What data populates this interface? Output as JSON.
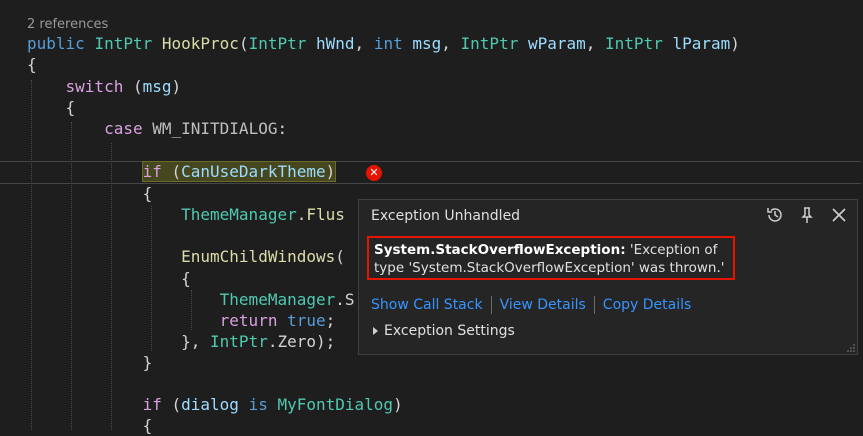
{
  "editor": {
    "codelens": "2 references",
    "code": {
      "l1": {
        "public": "public",
        "ret": "IntPtr",
        "fn": "HookProc",
        "p1t": "IntPtr",
        "p1": "hWnd",
        "p2t": "int",
        "p2": "msg",
        "p3t": "IntPtr",
        "p3": "wParam",
        "p4t": "IntPtr",
        "p4": "lParam"
      },
      "l2": "{",
      "l3": {
        "kw": "switch",
        "arg": "msg"
      },
      "l4": "{",
      "l5": {
        "kw": "case",
        "val": "WM_INITDIALOG"
      },
      "l6": {
        "kw": "if",
        "cond": "CanUseDarkTheme"
      },
      "l7": "{",
      "l8": {
        "ty": "ThemeManager",
        "fn": "Flus"
      },
      "l9": {
        "fn": "EnumChildWindows"
      },
      "l10": "{",
      "l11": {
        "ty": "ThemeManager",
        "rest": ".S"
      },
      "l12": {
        "kw": "return",
        "val": "true"
      },
      "l13": {
        "pre": "}, ",
        "ty": "IntPtr",
        "rest": ".Zero);"
      },
      "l14": "}",
      "l15": {
        "kw": "if",
        "v": "dialog",
        "is": "is",
        "ty": "MyFontDialog"
      },
      "l16": "{"
    }
  },
  "popup": {
    "title": "Exception Unhandled",
    "exception_type": "System.StackOverflowException:",
    "message": "'Exception of type 'System.StackOverflowException' was thrown.'",
    "links": [
      "Show Call Stack",
      "View Details",
      "Copy Details"
    ],
    "settings_label": "Exception Settings",
    "icons": [
      "history-icon",
      "pin-icon",
      "close-icon"
    ]
  },
  "colors": {
    "error": "#e51400",
    "link": "#3794ff",
    "background": "#1e1e1e"
  }
}
